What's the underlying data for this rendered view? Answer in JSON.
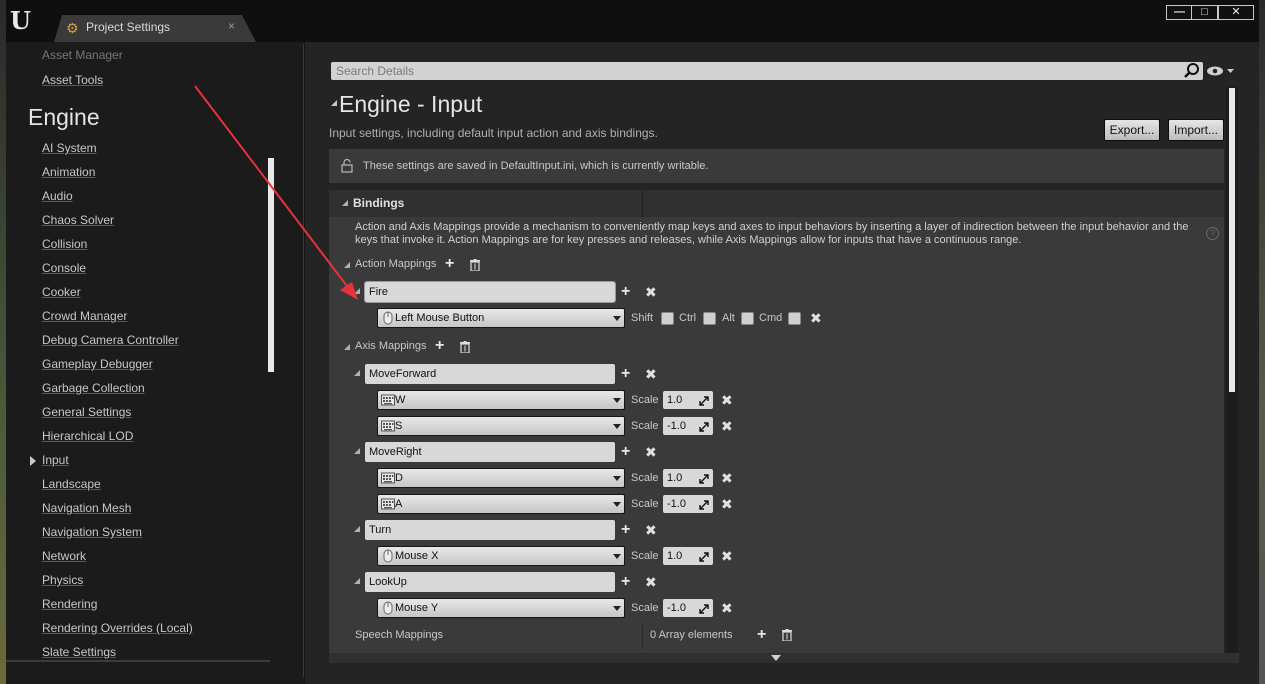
{
  "window": {
    "tab_title": "Project Settings",
    "tab_close": "×",
    "controls": {
      "minimize": "—",
      "maximize": "□",
      "close": "✕"
    }
  },
  "sidebar": {
    "partial_item": "Asset Manager",
    "asset_tools": "Asset Tools",
    "section_heading": "Engine",
    "items": [
      "AI System",
      "Animation",
      "Audio",
      "Chaos Solver",
      "Collision",
      "Console",
      "Cooker",
      "Crowd Manager",
      "Debug Camera Controller",
      "Gameplay Debugger",
      "Garbage Collection",
      "General Settings",
      "Hierarchical LOD",
      "Input",
      "Landscape",
      "Navigation Mesh",
      "Navigation System",
      "Network",
      "Physics",
      "Rendering",
      "Rendering Overrides (Local)",
      "Slate Settings"
    ],
    "selected_item": "Input"
  },
  "details": {
    "search_placeholder": "Search Details",
    "title": "Engine - Input",
    "description": "Input settings, including default input action and axis bindings.",
    "export_label": "Export...",
    "import_label": "Import...",
    "notice": "These settings are saved in DefaultInput.ini, which is currently writable."
  },
  "bindings": {
    "title": "Bindings",
    "description": "Action and Axis Mappings provide a mechanism to conveniently map keys and axes to input behaviors by inserting a layer of indirection between the input behavior and the keys that invoke it. Action Mappings are for key presses and releases, while Axis Mappings allow for inputs that have a continuous range.",
    "help": "?",
    "action_mappings_label": "Action Mappings",
    "axis_mappings_label": "Axis Mappings",
    "action": {
      "name": "Fire",
      "key": "Left Mouse Button",
      "key_icon": "mouse-icon",
      "modifiers": [
        "Shift",
        "Ctrl",
        "Alt",
        "Cmd"
      ]
    },
    "scale_label": "Scale",
    "axes": [
      {
        "name": "MoveForward",
        "keys": [
          {
            "key": "W",
            "icon": "keyboard-icon",
            "scale": "1.0"
          },
          {
            "key": "S",
            "icon": "keyboard-icon",
            "scale": "-1.0"
          }
        ]
      },
      {
        "name": "MoveRight",
        "keys": [
          {
            "key": "D",
            "icon": "keyboard-icon",
            "scale": "1.0"
          },
          {
            "key": "A",
            "icon": "keyboard-icon",
            "scale": "-1.0"
          }
        ]
      },
      {
        "name": "Turn",
        "keys": [
          {
            "key": "Mouse X",
            "icon": "mouse-icon",
            "scale": "1.0"
          }
        ]
      },
      {
        "name": "LookUp",
        "keys": [
          {
            "key": "Mouse Y",
            "icon": "mouse-icon",
            "scale": "-1.0"
          }
        ]
      }
    ],
    "speech": {
      "label": "Speech Mappings",
      "value": "0 Array elements"
    }
  },
  "colors": {
    "annotation_arrow": "#e8323a",
    "panel": "#3a3a3a",
    "field": "#d8d8d8"
  }
}
